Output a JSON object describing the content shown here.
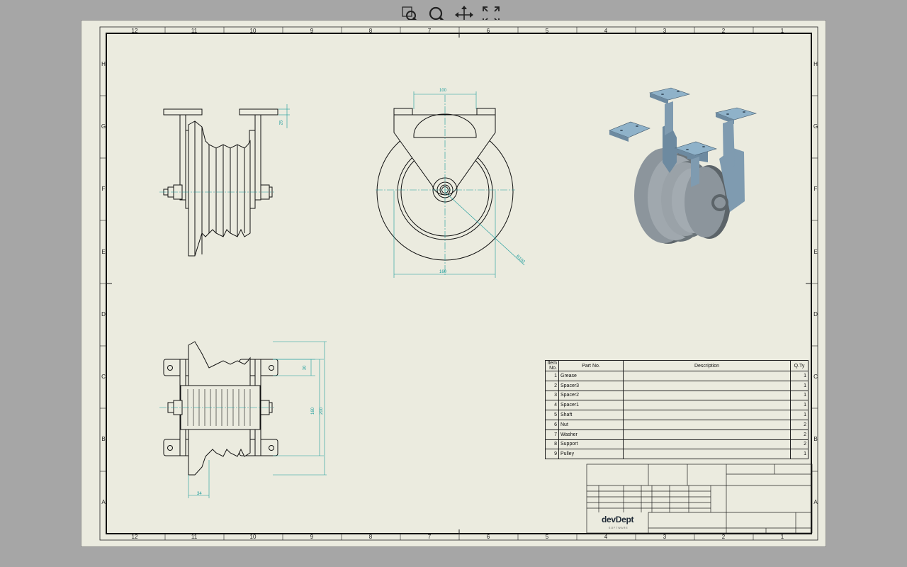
{
  "toolbar": {
    "buttons": [
      {
        "name": "zoom-window",
        "icon": "zoom-window-icon"
      },
      {
        "name": "zoom",
        "icon": "magnifier-icon"
      },
      {
        "name": "pan",
        "icon": "pan-arrows-icon"
      },
      {
        "name": "fit-all",
        "icon": "fit-all-icon"
      }
    ]
  },
  "sheet": {
    "zones_columns": [
      "12",
      "11",
      "10",
      "9",
      "8",
      "7",
      "6",
      "5",
      "4",
      "3",
      "2",
      "1"
    ],
    "zones_rows": [
      "H",
      "G",
      "F",
      "E",
      "D",
      "C",
      "B",
      "A"
    ],
    "dimensions": {
      "side_top": "25",
      "front_width_top": "100",
      "front_width_bottom": "160",
      "front_radius": "R102",
      "top_view_small": "30",
      "top_view_mid": "160",
      "top_view_large": "200",
      "top_view_bottom": "34"
    }
  },
  "bom": {
    "headers": {
      "item": "Item No.",
      "part": "Part No.",
      "desc": "Description",
      "qty": "Q.Ty"
    },
    "rows": [
      {
        "item": "1",
        "part": "Grease",
        "desc": "",
        "qty": "1"
      },
      {
        "item": "2",
        "part": "Spacer3",
        "desc": "",
        "qty": "1"
      },
      {
        "item": "3",
        "part": "Spacer2",
        "desc": "",
        "qty": "1"
      },
      {
        "item": "4",
        "part": "Spacer1",
        "desc": "",
        "qty": "1"
      },
      {
        "item": "5",
        "part": "Shaft",
        "desc": "",
        "qty": "1"
      },
      {
        "item": "6",
        "part": "Nut",
        "desc": "",
        "qty": "2"
      },
      {
        "item": "7",
        "part": "Washer",
        "desc": "",
        "qty": "2"
      },
      {
        "item": "8",
        "part": "Support",
        "desc": "",
        "qty": "2"
      },
      {
        "item": "9",
        "part": "Pulley",
        "desc": "",
        "qty": "1"
      }
    ]
  },
  "title_block": {
    "logo_name": "devDept",
    "logo_tag": "SOFTWARE"
  },
  "colors": {
    "sheet": "#ebebdf",
    "background": "#a6a6a6",
    "dimension": "#1a9b9b",
    "model_grey": "#8c959c",
    "model_blue": "#8fb2c9"
  }
}
